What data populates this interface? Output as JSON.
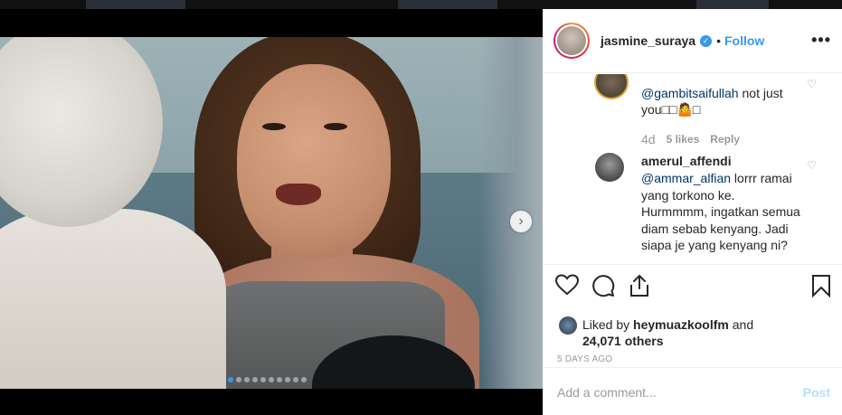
{
  "post": {
    "username": "jasmine_suraya",
    "separator": "•",
    "follow_label": "Follow",
    "more_label": "•••"
  },
  "media": {
    "next_label": "›",
    "carousel_count": 10,
    "carousel_active": 0
  },
  "comments": [
    {
      "mention": "@gambitsaifullah",
      "text": " not just you□□🤷□",
      "time": "4d",
      "likes": "5 likes",
      "reply_label": "Reply"
    },
    {
      "username": "amerul_affendi",
      "mention": "@ammar_alfian",
      "text": " lorrr ramai yang torkono ke. Hurmmmm, ingatkan semua diam sebab kenyang. Jadi siapa je yang kenyang ni?"
    }
  ],
  "likes": {
    "prefix": "Liked by ",
    "user": "heymuazkoolfm",
    "and": " and",
    "count": "24,071 others"
  },
  "date": "5 DAYS AGO",
  "composer": {
    "placeholder": "Add a comment...",
    "post_label": "Post"
  },
  "colors": {
    "accent": "#3897f0",
    "post_disabled": "#b2dffc",
    "text": "#262626",
    "muted": "#999999"
  },
  "icons": [
    "heart-icon",
    "comment-icon",
    "share-icon",
    "bookmark-icon",
    "verified-badge-icon",
    "more-options-icon"
  ]
}
